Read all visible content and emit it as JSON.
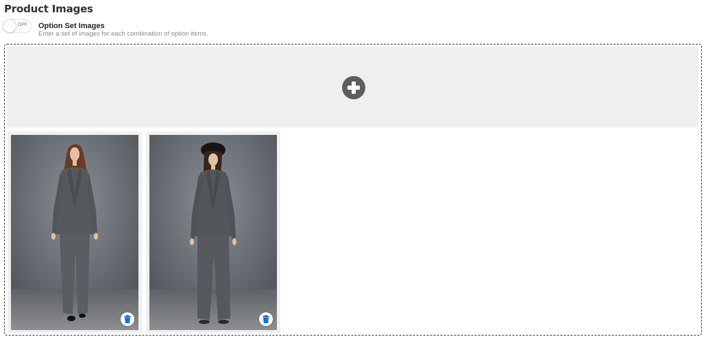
{
  "section": {
    "title": "Product Images"
  },
  "option_set": {
    "toggle_state": "OFF",
    "label": "Option Set Images",
    "description": "Enter a set of images for each combination of option items."
  },
  "dropzone": {
    "add_icon": "plus-circle-icon"
  },
  "images": [
    {
      "subject": "woman in grey suit",
      "delete_icon": "trash-icon"
    },
    {
      "subject": "woman in grey suit with black beret",
      "delete_icon": "trash-icon"
    }
  ],
  "colors": {
    "accent_blue": "#1f6fc6",
    "upload_bg": "#efefef",
    "add_icon": "#5e5e5e"
  }
}
